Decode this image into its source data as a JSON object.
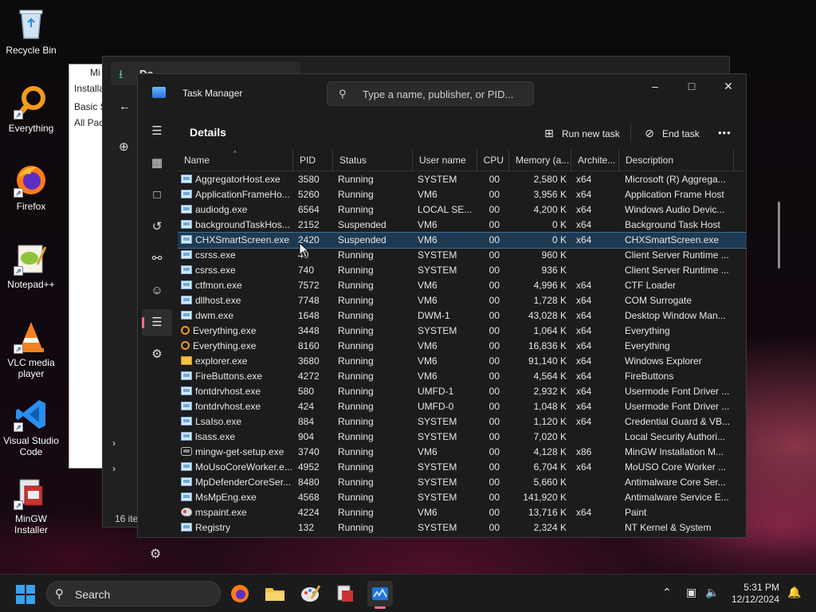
{
  "desktop": {
    "icons": [
      {
        "label": "Recycle Bin"
      },
      {
        "label": "Everything"
      },
      {
        "label": "Firefox"
      },
      {
        "label": "Notepad++"
      },
      {
        "label": "VLC media player"
      },
      {
        "label": "Visual Studio Code"
      },
      {
        "label": "MinGW Installer"
      }
    ]
  },
  "bg_windows": {
    "installer_lines": [
      "Mi",
      "Installa",
      "Basic S",
      "All Pac"
    ],
    "explorer": {
      "status": "16 ite",
      "tab_title": "Do"
    }
  },
  "task_manager": {
    "title": "Task Manager",
    "search_placeholder": "Type a name, publisher, or PID...",
    "page_title": "Details",
    "run_new_task": "Run new task",
    "end_task": "End task",
    "more": "•••",
    "columns": {
      "name": "Name",
      "pid": "PID",
      "status": "Status",
      "user": "User name",
      "cpu": "CPU",
      "memory": "Memory (a...",
      "arch": "Archite...",
      "desc": "Description"
    },
    "rows": [
      {
        "name": "AggregatorHost.exe",
        "pid": "3580",
        "status": "Running",
        "user": "SYSTEM",
        "cpu": "00",
        "mem": "2,580 K",
        "arch": "x64",
        "desc": "Microsoft (R) Aggrega...",
        "icon": "app"
      },
      {
        "name": "ApplicationFrameHo...",
        "pid": "5260",
        "status": "Running",
        "user": "VM6",
        "cpu": "00",
        "mem": "3,956 K",
        "arch": "x64",
        "desc": "Application Frame Host",
        "icon": "app"
      },
      {
        "name": "audiodg.exe",
        "pid": "6564",
        "status": "Running",
        "user": "LOCAL SE...",
        "cpu": "00",
        "mem": "4,200 K",
        "arch": "x64",
        "desc": "Windows Audio Devic...",
        "icon": "app"
      },
      {
        "name": "backgroundTaskHos...",
        "pid": "2152",
        "status": "Suspended",
        "user": "VM6",
        "cpu": "00",
        "mem": "0 K",
        "arch": "x64",
        "desc": "Background Task Host",
        "icon": "app"
      },
      {
        "name": "CHXSmartScreen.exe",
        "pid": "2420",
        "status": "Suspended",
        "user": "VM6",
        "cpu": "00",
        "mem": "0 K",
        "arch": "x64",
        "desc": "CHXSmartScreen.exe",
        "icon": "app",
        "selected": true
      },
      {
        "name": "csrss.exe",
        "pid": "40",
        "status": "Running",
        "user": "SYSTEM",
        "cpu": "00",
        "mem": "960 K",
        "arch": "",
        "desc": "Client Server Runtime ...",
        "icon": "app"
      },
      {
        "name": "csrss.exe",
        "pid": "740",
        "status": "Running",
        "user": "SYSTEM",
        "cpu": "00",
        "mem": "936 K",
        "arch": "",
        "desc": "Client Server Runtime ...",
        "icon": "app"
      },
      {
        "name": "ctfmon.exe",
        "pid": "7572",
        "status": "Running",
        "user": "VM6",
        "cpu": "00",
        "mem": "4,996 K",
        "arch": "x64",
        "desc": "CTF Loader",
        "icon": "app"
      },
      {
        "name": "dllhost.exe",
        "pid": "7748",
        "status": "Running",
        "user": "VM6",
        "cpu": "00",
        "mem": "1,728 K",
        "arch": "x64",
        "desc": "COM Surrogate",
        "icon": "app"
      },
      {
        "name": "dwm.exe",
        "pid": "1648",
        "status": "Running",
        "user": "DWM-1",
        "cpu": "00",
        "mem": "43,028 K",
        "arch": "x64",
        "desc": "Desktop Window Man...",
        "icon": "app"
      },
      {
        "name": "Everything.exe",
        "pid": "3448",
        "status": "Running",
        "user": "SYSTEM",
        "cpu": "00",
        "mem": "1,064 K",
        "arch": "x64",
        "desc": "Everything",
        "icon": "orange"
      },
      {
        "name": "Everything.exe",
        "pid": "8160",
        "status": "Running",
        "user": "VM6",
        "cpu": "00",
        "mem": "16,836 K",
        "arch": "x64",
        "desc": "Everything",
        "icon": "orange"
      },
      {
        "name": "explorer.exe",
        "pid": "3680",
        "status": "Running",
        "user": "VM6",
        "cpu": "00",
        "mem": "91,140 K",
        "arch": "x64",
        "desc": "Windows Explorer",
        "icon": "folder"
      },
      {
        "name": "FireButtons.exe",
        "pid": "4272",
        "status": "Running",
        "user": "VM6",
        "cpu": "00",
        "mem": "4,564 K",
        "arch": "x64",
        "desc": "FireButtons",
        "icon": "app"
      },
      {
        "name": "fontdrvhost.exe",
        "pid": "580",
        "status": "Running",
        "user": "UMFD-1",
        "cpu": "00",
        "mem": "2,932 K",
        "arch": "x64",
        "desc": "Usermode Font Driver ...",
        "icon": "app"
      },
      {
        "name": "fontdrvhost.exe",
        "pid": "424",
        "status": "Running",
        "user": "UMFD-0",
        "cpu": "00",
        "mem": "1,048 K",
        "arch": "x64",
        "desc": "Usermode Font Driver ...",
        "icon": "app"
      },
      {
        "name": "LsaIso.exe",
        "pid": "884",
        "status": "Running",
        "user": "SYSTEM",
        "cpu": "00",
        "mem": "1,120 K",
        "arch": "x64",
        "desc": "Credential Guard & VB...",
        "icon": "app"
      },
      {
        "name": "lsass.exe",
        "pid": "904",
        "status": "Running",
        "user": "SYSTEM",
        "cpu": "00",
        "mem": "7,020 K",
        "arch": "",
        "desc": "Local Security Authori...",
        "icon": "app"
      },
      {
        "name": "mingw-get-setup.exe",
        "pid": "3740",
        "status": "Running",
        "user": "VM6",
        "cpu": "00",
        "mem": "4,128 K",
        "arch": "x86",
        "desc": "MinGW Installation M...",
        "icon": "gear"
      },
      {
        "name": "MoUsoCoreWorker.e...",
        "pid": "4952",
        "status": "Running",
        "user": "SYSTEM",
        "cpu": "00",
        "mem": "6,704 K",
        "arch": "x64",
        "desc": "MoUSO Core Worker ...",
        "icon": "app"
      },
      {
        "name": "MpDefenderCoreSer...",
        "pid": "8480",
        "status": "Running",
        "user": "SYSTEM",
        "cpu": "00",
        "mem": "5,660 K",
        "arch": "",
        "desc": "Antimalware Core Ser...",
        "icon": "app"
      },
      {
        "name": "MsMpEng.exe",
        "pid": "4568",
        "status": "Running",
        "user": "SYSTEM",
        "cpu": "00",
        "mem": "141,920 K",
        "arch": "",
        "desc": "Antimalware Service E...",
        "icon": "app"
      },
      {
        "name": "mspaint.exe",
        "pid": "4224",
        "status": "Running",
        "user": "VM6",
        "cpu": "00",
        "mem": "13,716 K",
        "arch": "x64",
        "desc": "Paint",
        "icon": "paint"
      },
      {
        "name": "Registry",
        "pid": "132",
        "status": "Running",
        "user": "SYSTEM",
        "cpu": "00",
        "mem": "2,324 K",
        "arch": "",
        "desc": "NT Kernel & System",
        "icon": "app"
      }
    ]
  },
  "taskbar": {
    "search_label": "Search",
    "time": "5:31 PM",
    "date": "12/12/2024"
  }
}
